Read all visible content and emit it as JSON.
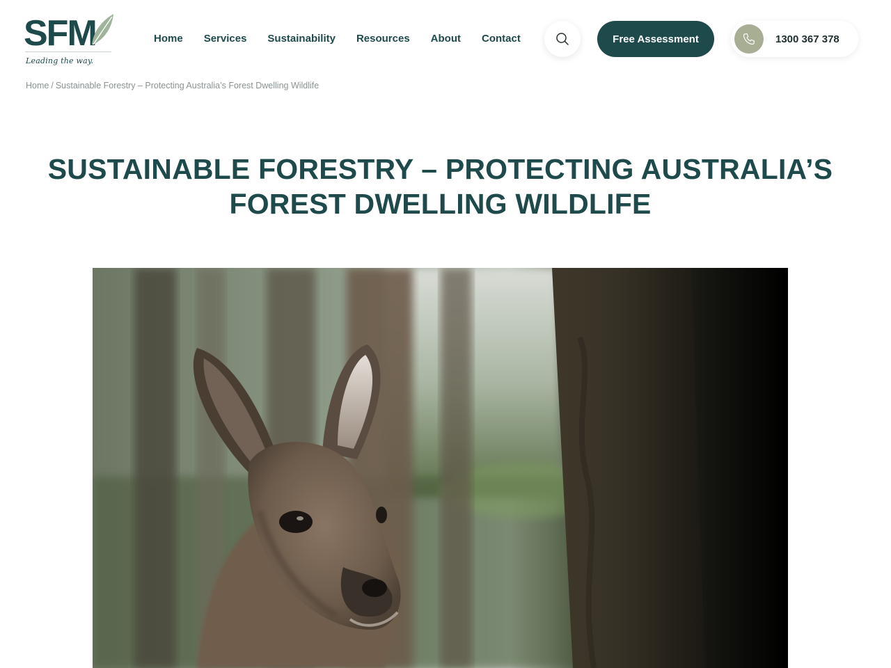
{
  "brand": {
    "logo_text": "SFM",
    "tagline": "Leading the way.",
    "color_primary": "#1f4a4c",
    "color_leaf": "#9fb49a",
    "color_phone_badge": "#a8ae94"
  },
  "nav": {
    "items": [
      {
        "label": "Home"
      },
      {
        "label": "Services"
      },
      {
        "label": "Sustainability"
      },
      {
        "label": "Resources"
      },
      {
        "label": "About"
      },
      {
        "label": "Contact"
      }
    ]
  },
  "header": {
    "search_icon": "search-icon",
    "cta_label": "Free Assessment",
    "phone_icon": "phone-icon",
    "phone_number": "1300 367 378"
  },
  "breadcrumb": {
    "home": "Home",
    "separator": "/",
    "current": "Sustainable Forestry – Protecting Australia’s Forest Dwelling Wildlife"
  },
  "article": {
    "title": "SUSTAINABLE FORESTRY – PROTECTING AUSTRALIA’S FOREST DWELLING WILDLIFE",
    "hero_image_subject": "kangaroo in forest"
  }
}
